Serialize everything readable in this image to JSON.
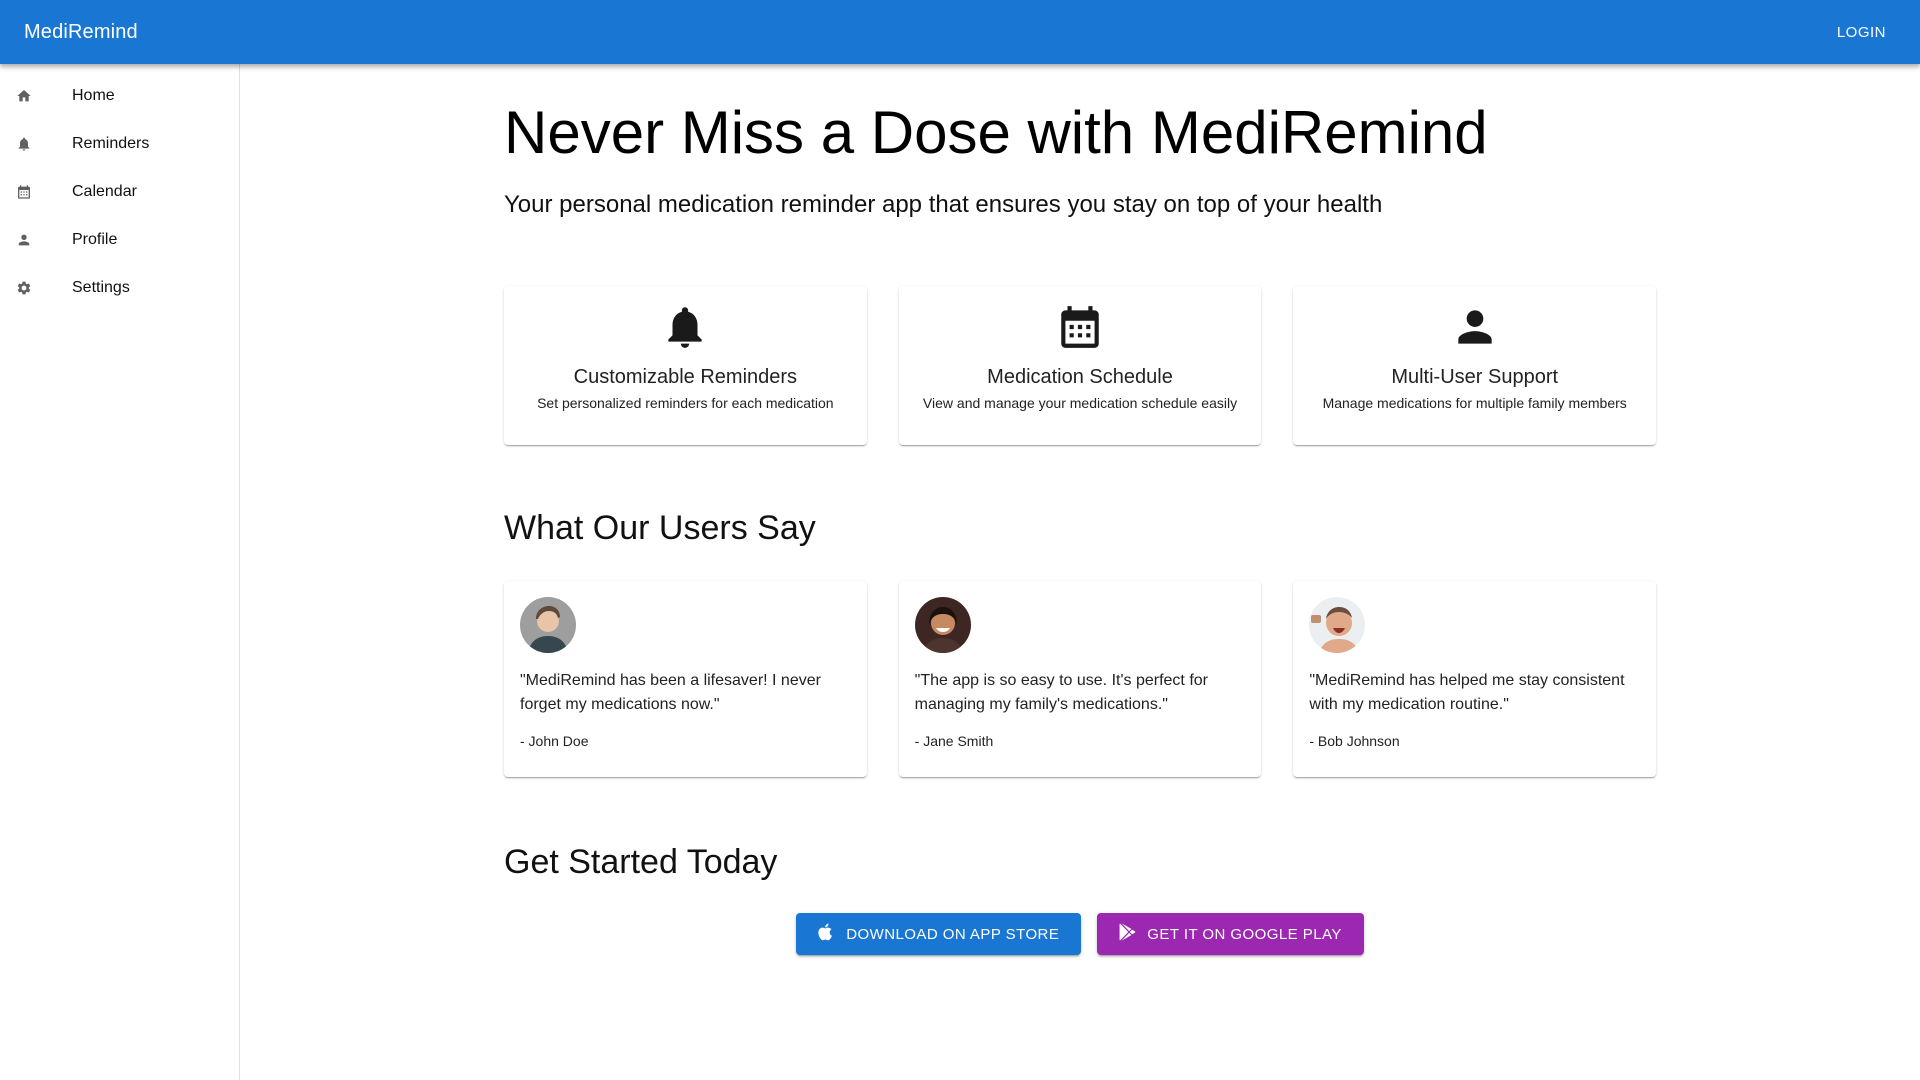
{
  "app": {
    "title": "MediRemind",
    "login_label": "LOGIN"
  },
  "colors": {
    "primary": "#1976d2",
    "secondary": "#9c27b0"
  },
  "sidebar": {
    "items": [
      {
        "label": "Home",
        "icon": "home-icon"
      },
      {
        "label": "Reminders",
        "icon": "bell-icon"
      },
      {
        "label": "Calendar",
        "icon": "calendar-icon"
      },
      {
        "label": "Profile",
        "icon": "person-icon"
      },
      {
        "label": "Settings",
        "icon": "gear-icon"
      }
    ]
  },
  "hero": {
    "title": "Never Miss a Dose with MediRemind",
    "subtitle": "Your personal medication reminder app that ensures you stay on top of your health"
  },
  "features": [
    {
      "icon": "bell-icon",
      "title": "Customizable Reminders",
      "description": "Set personalized reminders for each medication"
    },
    {
      "icon": "calendar-icon",
      "title": "Medication Schedule",
      "description": "View and manage your medication schedule easily"
    },
    {
      "icon": "person-icon",
      "title": "Multi-User Support",
      "description": "Manage medications for multiple family members"
    }
  ],
  "testimonials_section": {
    "title": "What Our Users Say"
  },
  "testimonials": [
    {
      "quote": "\"MediRemind has been a lifesaver! I never forget my medications now.\"",
      "author": "- John Doe"
    },
    {
      "quote": "\"The app is so easy to use. It's perfect for managing my family's medications.\"",
      "author": "- Jane Smith"
    },
    {
      "quote": "\"MediRemind has helped me stay consistent with my medication routine.\"",
      "author": "- Bob Johnson"
    }
  ],
  "cta_section": {
    "title": "Get Started Today",
    "app_store_label": "DOWNLOAD ON APP STORE",
    "google_play_label": "GET IT ON GOOGLE PLAY"
  }
}
